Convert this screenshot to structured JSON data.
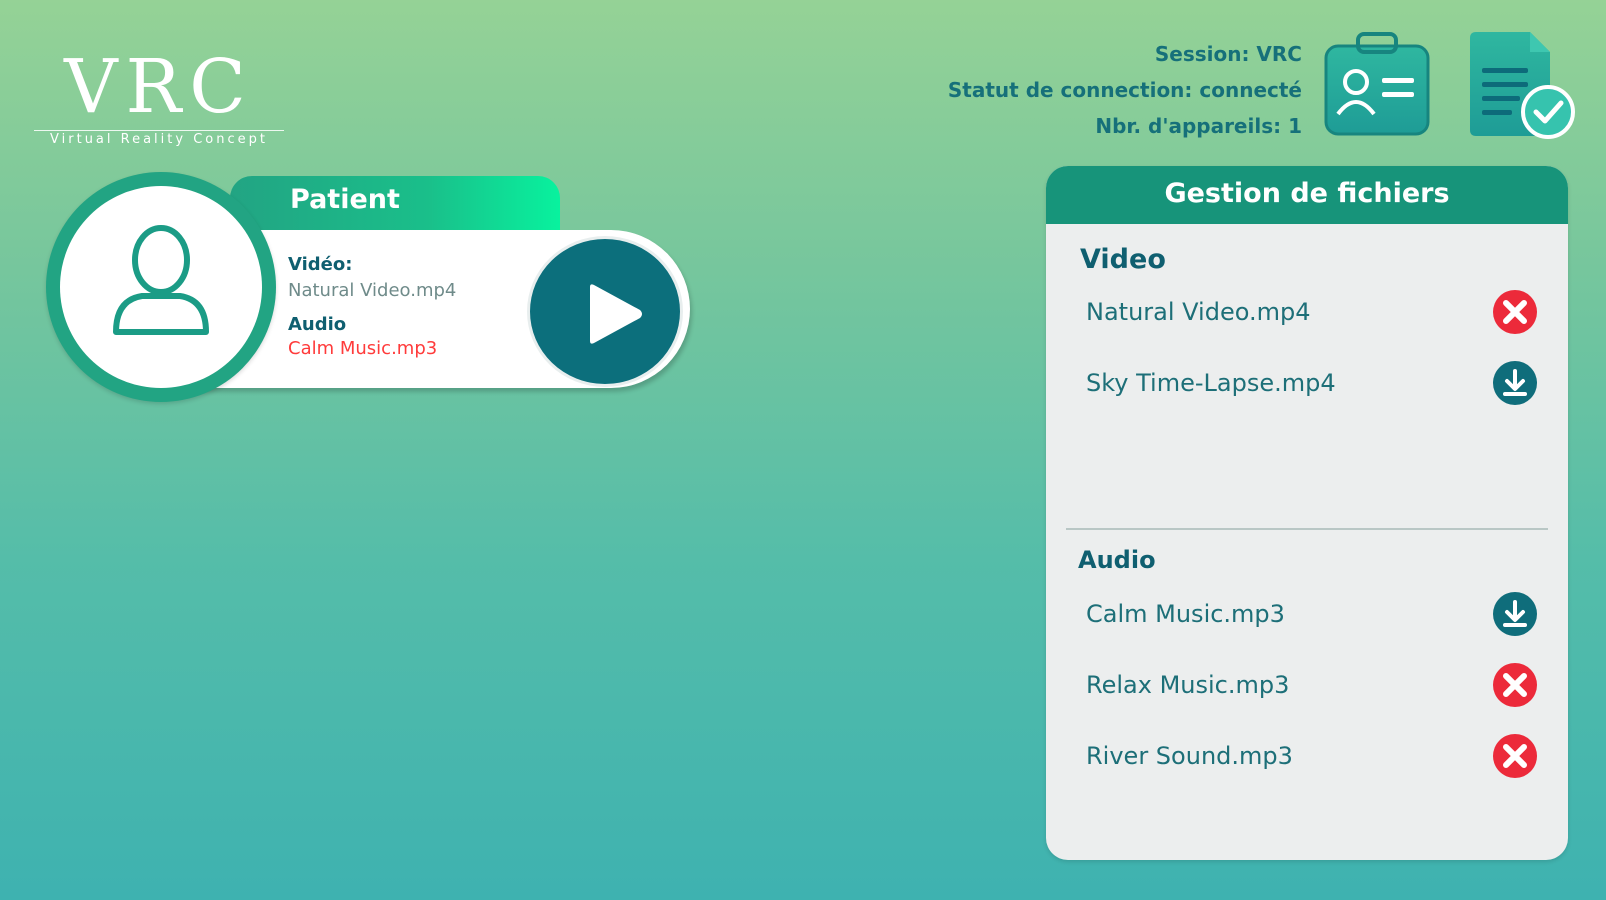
{
  "logo": {
    "letters": "VRC",
    "tagline": "Virtual Reality Concept"
  },
  "status": {
    "session": "Session: VRC",
    "connection": "Statut de connection: connecté",
    "devices": "Nbr. d'appareils: 1"
  },
  "header_icons": [
    "id-card-icon",
    "document-check-icon"
  ],
  "patient": {
    "tab_label": "Patient",
    "video_label": "Vidéo:",
    "video_value": "Natural Video.mp4",
    "audio_label": "Audio",
    "audio_value": "Calm Music.mp3",
    "play_icon": "play-icon"
  },
  "file_manager": {
    "title": "Gestion de fichiers",
    "video": {
      "title": "Video",
      "items": [
        {
          "name": "Natural Video.mp4",
          "action": "delete"
        },
        {
          "name": "Sky Time-Lapse.mp4",
          "action": "download"
        }
      ]
    },
    "audio": {
      "title": "Audio",
      "items": [
        {
          "name": "Calm Music.mp3",
          "action": "download"
        },
        {
          "name": "Relax Music.mp3",
          "action": "delete"
        },
        {
          "name": "River Sound.mp3",
          "action": "delete"
        }
      ]
    }
  },
  "colors": {
    "accent_dark": "#0c6f7c",
    "accent_green": "#22a483",
    "text_teal": "#16707a",
    "audio_value": "#ff3b3b",
    "delete_red": "#ec2a3a",
    "download_teal": "#0f6d7b"
  }
}
